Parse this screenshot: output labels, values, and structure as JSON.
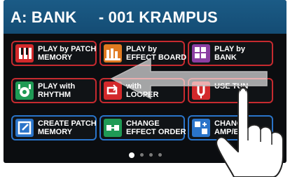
{
  "header": {
    "title": "A: BANK     - 001 KRAMPUS"
  },
  "tiles": [
    {
      "label": "PLAY by PATCH\nMEMORY",
      "icon": "patch-memory-icon",
      "style": "red"
    },
    {
      "label": "PLAY by\nEFFECT BOARD",
      "icon": "effect-board-icon",
      "style": "red"
    },
    {
      "label": "PLAY by\nBANK",
      "icon": "bank-icon",
      "style": "red"
    },
    {
      "label": "PLAY with\nRHYTHM",
      "icon": "rhythm-icon",
      "style": "red"
    },
    {
      "label": "with\nLOOPER",
      "icon": "looper-icon",
      "style": "red"
    },
    {
      "label": "USE TUN",
      "icon": "tuner-icon",
      "style": "red"
    },
    {
      "label": "CREATE PATCH\nMEMORY",
      "icon": "create-patch-icon",
      "style": "blue"
    },
    {
      "label": "CHANGE\nEFFECT ORDER",
      "icon": "effect-order-icon",
      "style": "blue"
    },
    {
      "label": "CHANGE\nAMP/EFF",
      "icon": "amp-effect-icon",
      "style": "blue"
    }
  ],
  "pager": {
    "count": 4,
    "active": 0
  },
  "colors": {
    "header": "#1b5b86",
    "tile_red": "#c62a2f",
    "tile_blue": "#2a74c9",
    "background": "#0b0d10"
  }
}
